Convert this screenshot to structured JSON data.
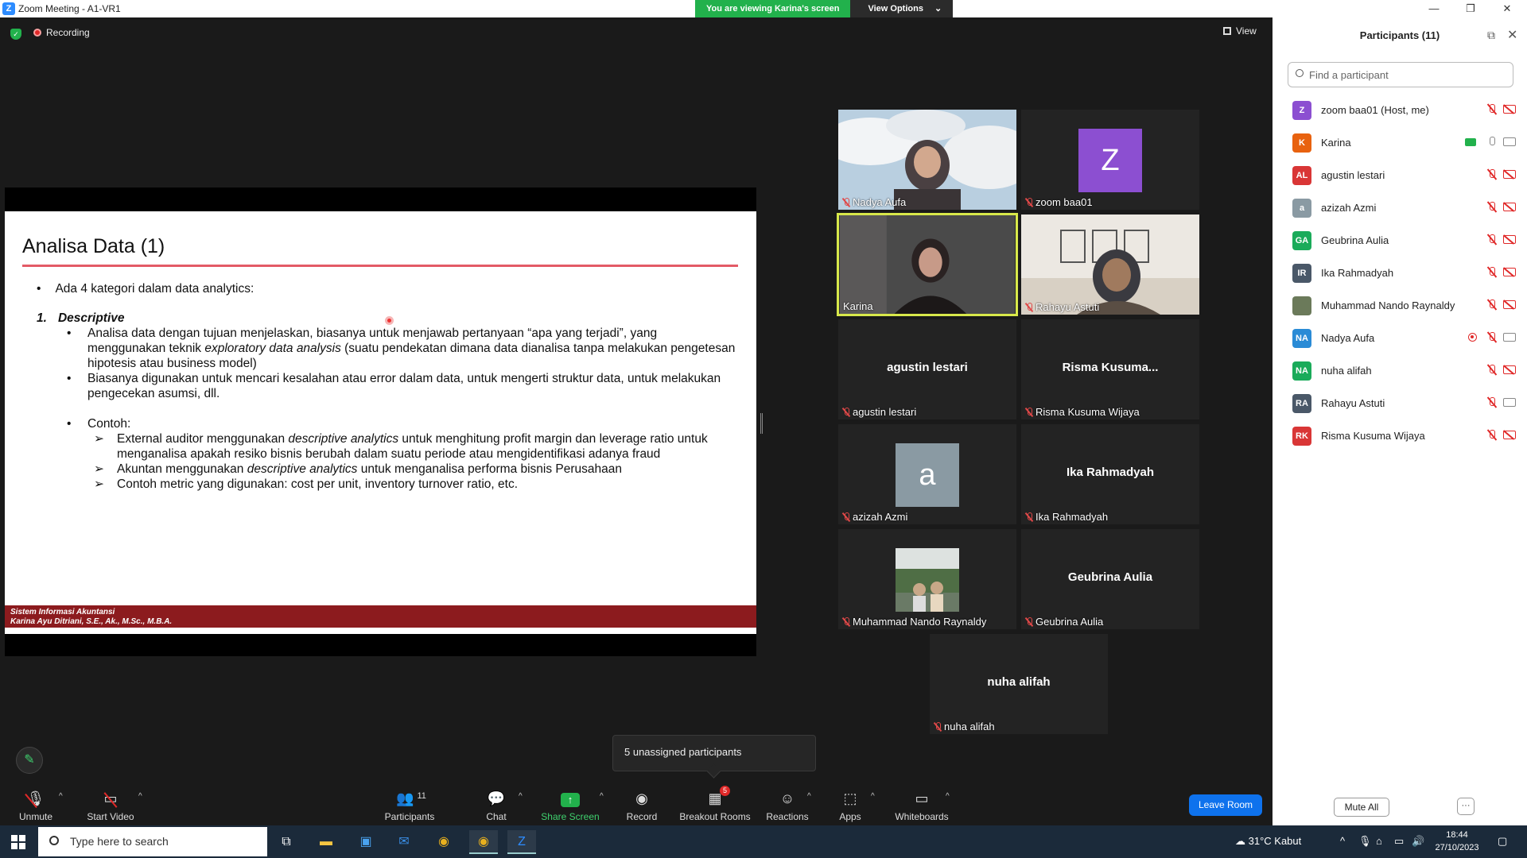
{
  "window": {
    "title": "Zoom Meeting - A1-VR1",
    "viewing_banner": "You are viewing Karina's screen",
    "view_options": "View Options"
  },
  "stage": {
    "recording_label": "Recording",
    "view_label": "View"
  },
  "slide": {
    "title": "Analisa Data (1)",
    "bullet1": "Ada 4 kategori dalam data analytics:",
    "section_num": "1.",
    "section_title": "Descriptive",
    "point1_a": "Analisa data dengan tujuan menjelaskan, biasanya untuk menjawab pertanyaan “apa yang terjadi”, yang menggunakan teknik ",
    "point1_em": "exploratory data analysis",
    "point1_b": " (suatu pendekatan dimana data dianalisa tanpa melakukan pengetesan hipotesis atau business model)",
    "point2": "Biasanya digunakan untuk mencari kesalahan atau error dalam data, untuk mengerti struktur data, untuk melakukan pengecekan asumsi, dll.",
    "contoh": "Contoh:",
    "ex1_a": "External auditor menggunakan ",
    "ex1_em": "descriptive analytics",
    "ex1_b": " untuk menghitung profit margin dan leverage ratio untuk menganalisa apakah resiko bisnis berubah dalam suatu periode atau mengidentifikasi adanya fraud",
    "ex2_a": "Akuntan menggunakan ",
    "ex2_em": "descriptive analytics",
    "ex2_b": " untuk menganalisa performa bisnis Perusahaan",
    "ex3": "Contoh metric yang digunakan: cost per unit, inventory turnover ratio, etc.",
    "footer_line1": "Sistem Informasi Akuntansi",
    "footer_line2": "Karina Ayu Ditriani, S.E., Ak., M.Sc., M.B.A."
  },
  "tiles": {
    "nadya": "Nadya Aufa",
    "zoom": "zoom baa01",
    "zoom_initial": "Z",
    "karina": "Karina",
    "rahayu": "Rahayu Astuti",
    "agustin_big": "agustin lestari",
    "agustin": "agustin lestari",
    "risma_big": "Risma  Kusuma...",
    "risma": "Risma Kusuma Wijaya",
    "azizah_initial": "a",
    "azizah": "azizah Azmi",
    "ika_big": "Ika Rahmadyah",
    "ika": "Ika Rahmadyah",
    "nando": "Muhammad Nando Raynaldy",
    "geubrina_big": "Geubrina Aulia",
    "geubrina": "Geubrina Aulia",
    "nuha_big": "nuha alifah",
    "nuha": "nuha alifah"
  },
  "popup": {
    "text": "5 unassigned participants"
  },
  "toolbar": {
    "unmute": "Unmute",
    "start_video": "Start Video",
    "participants": "Participants",
    "participants_count": "11",
    "chat": "Chat",
    "share_screen": "Share Screen",
    "record": "Record",
    "breakout_rooms": "Breakout Rooms",
    "breakout_badge": "5",
    "reactions": "Reactions",
    "apps": "Apps",
    "whiteboards": "Whiteboards",
    "leave_room": "Leave Room"
  },
  "panel": {
    "title": "Participants (11)",
    "search_placeholder": "Find a participant",
    "mute_all": "Mute All",
    "more": "···",
    "participants": [
      {
        "initials": "Z",
        "name": "zoom baa01 (Host, me)",
        "color": "#8c4fd1"
      },
      {
        "initials": "K",
        "name": "Karina",
        "color": "#e8620f"
      },
      {
        "initials": "AL",
        "name": "agustin lestari",
        "color": "#d93636"
      },
      {
        "initials": "a",
        "name": "azizah Azmi",
        "color": "#8a9aa3"
      },
      {
        "initials": "GA",
        "name": "Geubrina Aulia",
        "color": "#1aab5a"
      },
      {
        "initials": "IR",
        "name": "Ika Rahmadyah",
        "color": "#4a5868"
      },
      {
        "initials": "",
        "name": "Muhammad Nando Raynaldy",
        "color": "#6b7a5a"
      },
      {
        "initials": "NA",
        "name": "Nadya Aufa",
        "color": "#2a8bd6"
      },
      {
        "initials": "NA",
        "name": "nuha alifah",
        "color": "#1aab5a"
      },
      {
        "initials": "RA",
        "name": "Rahayu Astuti",
        "color": "#4a5868"
      },
      {
        "initials": "RK",
        "name": "Risma Kusuma Wijaya",
        "color": "#d93636"
      }
    ]
  },
  "taskbar": {
    "search_placeholder": "Type here to search",
    "weather": "31°C  Kabut",
    "time": "18:44",
    "date": "27/10/2023"
  }
}
